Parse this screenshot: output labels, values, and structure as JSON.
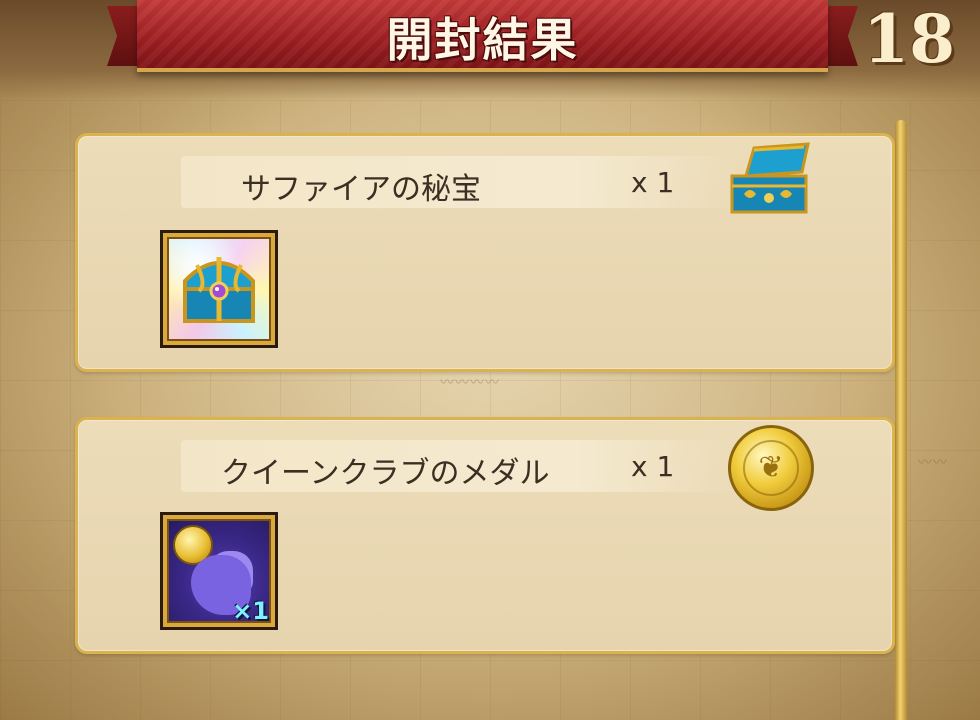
{
  "header": {
    "title": "開封結果",
    "counter": "18"
  },
  "results": [
    {
      "name": "サファイアの秘宝",
      "quantity": "x 1",
      "icon": "sapphire-treasure-chest-icon"
    },
    {
      "name": "クイーンクラブのメダル",
      "quantity": "x 1",
      "thumbnail_badge": "×1",
      "icon": "queen-crab-medal-icon"
    }
  ],
  "colors": {
    "ribbon": "#9e1f22",
    "panel": "#e8d6b1",
    "panel_border": "#dcb24e",
    "text": "#3b2e22",
    "scrollbar": "#f1d274"
  }
}
